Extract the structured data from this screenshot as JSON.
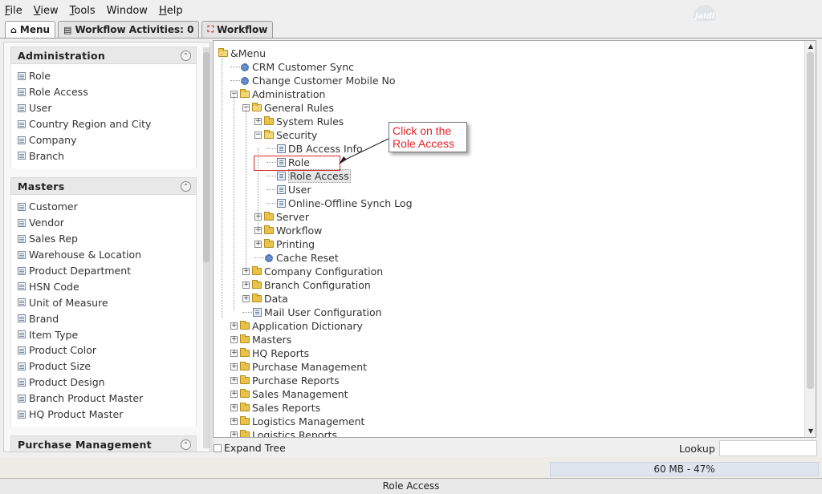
{
  "menu": {
    "items": [
      {
        "label": "File",
        "mnemonic": "F",
        "rest": "ile"
      },
      {
        "label": "View",
        "mnemonic": "V",
        "rest": "iew"
      },
      {
        "label": "Tools",
        "mnemonic": "T",
        "rest": "ools"
      },
      {
        "label": "Window",
        "mnemonic": "",
        "rest": "Window"
      },
      {
        "label": "Help",
        "mnemonic": "H",
        "rest": "elp"
      }
    ],
    "logo_text": "jaldi"
  },
  "tabs": [
    {
      "label": "Menu",
      "icon": "home-icon",
      "active": true
    },
    {
      "label": "Workflow Activities: 0",
      "icon": "list-icon",
      "active": false
    },
    {
      "label": "Workflow",
      "icon": "workflow-icon",
      "active": false
    }
  ],
  "sidebar": {
    "sections": [
      {
        "title": "Administration",
        "items": [
          "Role",
          "Role Access",
          "User",
          "Country Region and City",
          "Company",
          "Branch"
        ]
      },
      {
        "title": "Masters",
        "items": [
          "Customer",
          "Vendor",
          "Sales Rep",
          "Warehouse & Location",
          "Product Department",
          "HSN Code",
          "Unit of Measure",
          "Brand",
          "Item Type",
          "Product Color",
          "Product Size",
          "Product Design",
          "Branch Product Master",
          "HQ Product Master"
        ]
      },
      {
        "title": "Purchase Management",
        "items": []
      }
    ]
  },
  "tree": {
    "rows": [
      {
        "label": "&Menu",
        "kind": "folder-open",
        "toggle": "",
        "level": 0
      },
      {
        "label": "CRM Customer Sync",
        "kind": "process",
        "toggle": "",
        "level": 1
      },
      {
        "label": "Change Customer Mobile No",
        "kind": "process",
        "toggle": "",
        "level": 1
      },
      {
        "label": "Administration",
        "kind": "folder-open",
        "toggle": "−",
        "level": 1
      },
      {
        "label": "General Rules",
        "kind": "folder-open",
        "toggle": "−",
        "level": 2
      },
      {
        "label": "System Rules",
        "kind": "folder",
        "toggle": "+",
        "level": 3
      },
      {
        "label": "Security",
        "kind": "folder-open",
        "toggle": "−",
        "level": 3
      },
      {
        "label": "DB Access Info",
        "kind": "window",
        "toggle": "",
        "level": 4
      },
      {
        "label": "Role",
        "kind": "window",
        "toggle": "",
        "level": 4
      },
      {
        "label": "Role Access",
        "kind": "window",
        "toggle": "",
        "level": 4
      },
      {
        "label": "User",
        "kind": "window",
        "toggle": "",
        "level": 4
      },
      {
        "label": "Online-Offline Synch Log",
        "kind": "window",
        "toggle": "",
        "level": 4
      },
      {
        "label": "Server",
        "kind": "folder",
        "toggle": "+",
        "level": 3
      },
      {
        "label": "Workflow",
        "kind": "folder",
        "toggle": "+",
        "level": 3
      },
      {
        "label": "Printing",
        "kind": "folder",
        "toggle": "+",
        "level": 3
      },
      {
        "label": "Cache Reset",
        "kind": "process",
        "toggle": "",
        "level": 3
      },
      {
        "label": "Company Configuration",
        "kind": "folder",
        "toggle": "+",
        "level": 2
      },
      {
        "label": "Branch Configuration",
        "kind": "folder",
        "toggle": "+",
        "level": 2
      },
      {
        "label": "Data",
        "kind": "folder",
        "toggle": "+",
        "level": 2
      },
      {
        "label": "Mail User Configuration",
        "kind": "window",
        "toggle": "",
        "level": 2
      },
      {
        "label": "Application Dictionary",
        "kind": "folder",
        "toggle": "+",
        "level": 1
      },
      {
        "label": "Masters",
        "kind": "folder",
        "toggle": "+",
        "level": 1
      },
      {
        "label": "HQ Reports",
        "kind": "folder",
        "toggle": "+",
        "level": 1
      },
      {
        "label": "Purchase Management",
        "kind": "folder",
        "toggle": "+",
        "level": 1
      },
      {
        "label": "Purchase Reports",
        "kind": "folder",
        "toggle": "+",
        "level": 1
      },
      {
        "label": "Sales Management",
        "kind": "folder",
        "toggle": "+",
        "level": 1
      },
      {
        "label": "Sales Reports",
        "kind": "folder",
        "toggle": "+",
        "level": 1
      },
      {
        "label": "Logistics Management",
        "kind": "folder",
        "toggle": "+",
        "level": 1
      },
      {
        "label": "Logistics Reports",
        "kind": "folder",
        "toggle": "+",
        "level": 1
      }
    ],
    "selected": "Role Access"
  },
  "callout": {
    "text": "Click on the Role Access",
    "color": "#e8232b"
  },
  "bottom": {
    "expand_label": "Expand Tree",
    "lookup_label": "Lookup",
    "lookup_value": ""
  },
  "memory": "60 MB - 47%",
  "status": "Role Access"
}
